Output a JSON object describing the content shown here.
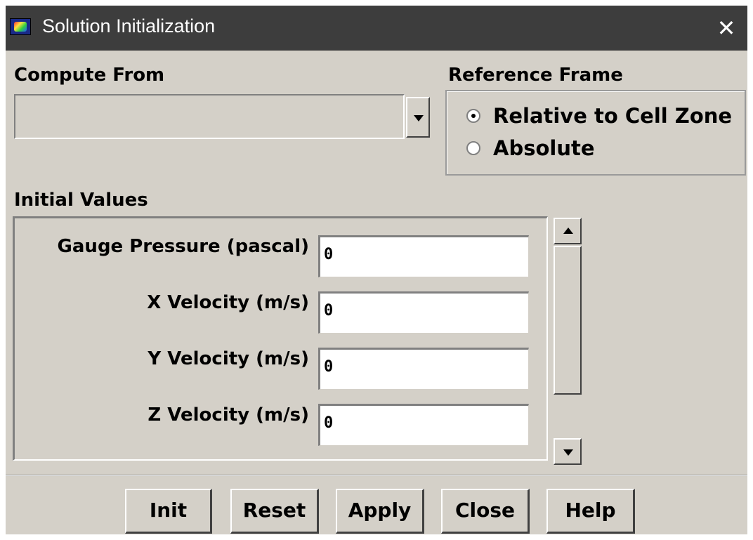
{
  "window": {
    "title": "Solution Initialization",
    "icon": "fluent-app-icon",
    "close_glyph": "✕"
  },
  "compute_from": {
    "label": "Compute From",
    "selected_value": ""
  },
  "reference_frame": {
    "label": "Reference Frame",
    "options": [
      {
        "label": "Relative to Cell Zone",
        "selected": true
      },
      {
        "label": "Absolute",
        "selected": false
      }
    ]
  },
  "initial_values": {
    "label": "Initial Values",
    "fields": [
      {
        "label": "Gauge Pressure (pascal)",
        "value": "0"
      },
      {
        "label": "X Velocity (m/s)",
        "value": "0"
      },
      {
        "label": "Y Velocity (m/s)",
        "value": "0"
      },
      {
        "label": "Z Velocity (m/s)",
        "value": "0"
      }
    ]
  },
  "buttons": {
    "init": "Init",
    "reset": "Reset",
    "apply": "Apply",
    "close": "Close",
    "help": "Help"
  },
  "colors": {
    "titlebar": "#3d3d3d",
    "dialog_bg": "#d4d0c8",
    "field_bg": "#ffffff"
  }
}
